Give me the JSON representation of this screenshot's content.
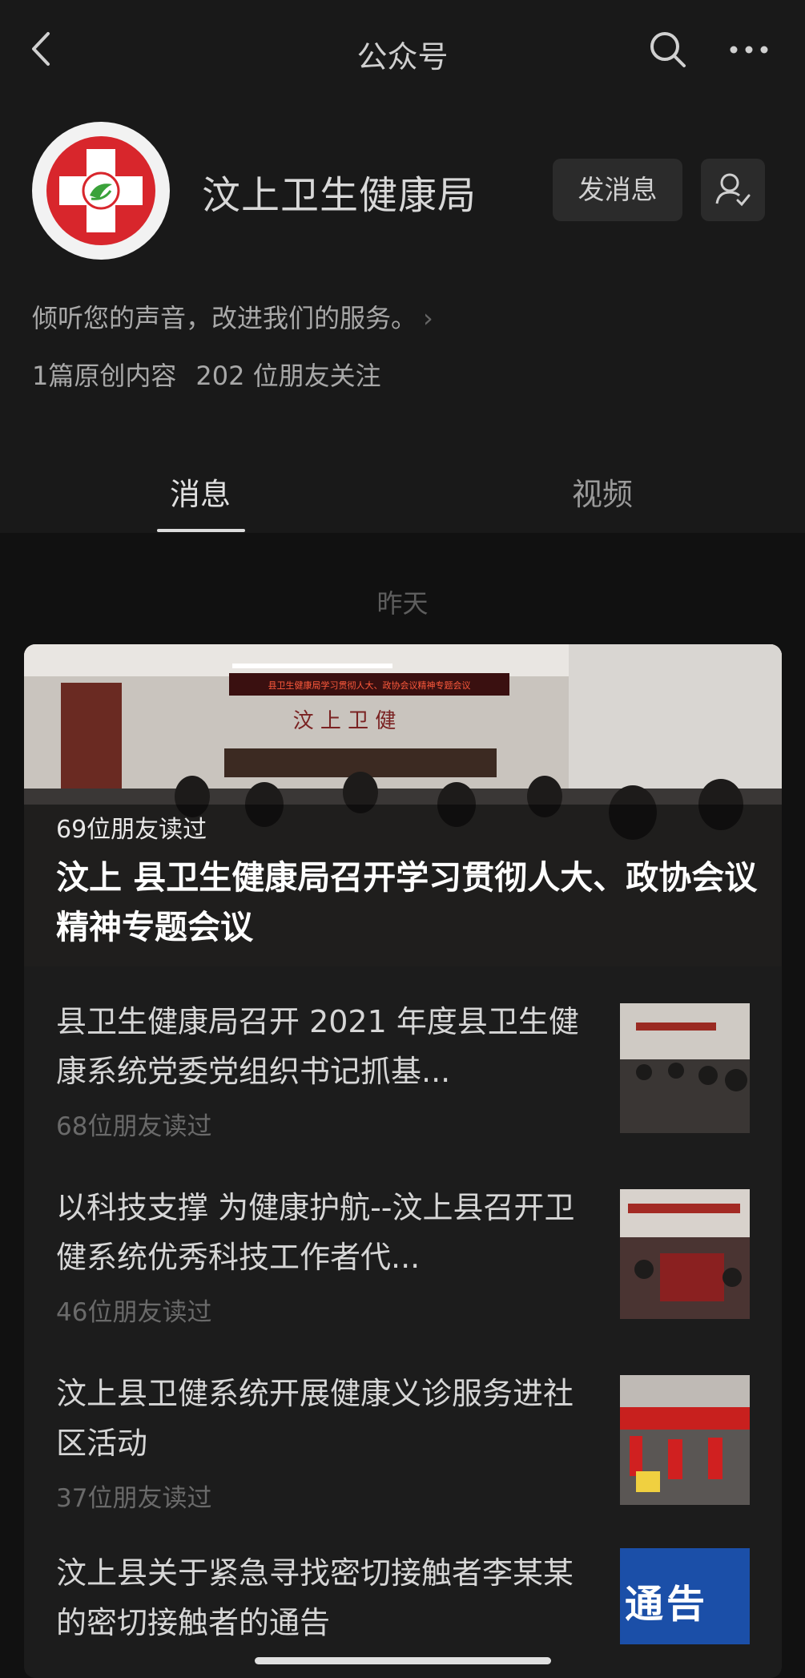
{
  "nav": {
    "title": "公众号"
  },
  "account": {
    "name": "汶上卫生健康局",
    "message_button": "发消息",
    "description": "倾听您的声音，改进我们的服务。",
    "original_count": "1篇原创内容",
    "followers": "202 位朋友关注"
  },
  "tabs": [
    {
      "label": "消息",
      "active": true
    },
    {
      "label": "视频",
      "active": false
    }
  ],
  "feed": {
    "date": "昨天",
    "hero": {
      "reads": "69位朋友读过",
      "title": "汶上 县卫生健康局召开学习贯彻人大、政协会议精神专题会议",
      "banner_text": "县卫生健康局学习贯彻人大、政协会议精神专题会议",
      "wall_text": "汶 上 卫 健"
    },
    "items": [
      {
        "title": "县卫生健康局召开 2021 年度县卫生健康系统党委党组织书记抓基...",
        "reads": "68位朋友读过"
      },
      {
        "title": "以科技支撑 为健康护航--汶上县召开卫健系统优秀科技工作者代...",
        "reads": "46位朋友读过"
      },
      {
        "title": "汶上县卫健系统开展健康义诊服务进社区活动",
        "reads": "37位朋友读过"
      },
      {
        "title": "汶上县关于紧急寻找密切接触者李某某的密切接触者的通告",
        "reads": "",
        "thumb_text": "通告"
      }
    ]
  },
  "colors": {
    "background": "#111111",
    "header_background": "#191919",
    "card_background": "#1c1c1c",
    "logo_red": "#d8262c",
    "logo_green": "#3aa23a"
  }
}
